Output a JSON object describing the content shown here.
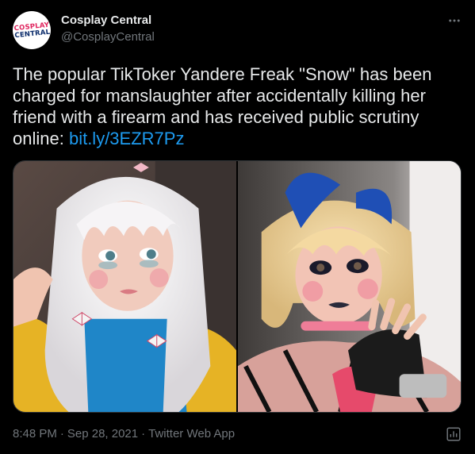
{
  "account": {
    "display_name": "Cosplay Central",
    "handle": "@CosplayCentral",
    "avatar_text_line1": "COSPLAY",
    "avatar_text_line2": "CENTRAL"
  },
  "tweet": {
    "text": "The popular TikToker Yandere Freak \"Snow\" has been charged for manslaughter after accidentally killing her friend with a firearm and has received public scrutiny online: ",
    "link_text": "bit.ly/3EZR7Pz"
  },
  "media": {
    "photo_count": 2,
    "left_photo": "photo of a person in a long white wig and a blue top with a yellow cardigan",
    "right_photo": "photo of a person in a blonde bob wig with blue cat ears and a pink choker"
  },
  "footer": {
    "time": "8:48 PM",
    "separator": "·",
    "date": "Sep 28, 2021",
    "source": "Twitter Web App"
  },
  "icons": {
    "more": "more-horizontal-icon",
    "analytics": "analytics-icon"
  },
  "colors": {
    "background": "#000000",
    "text": "#e7e9ea",
    "secondary": "#71767b",
    "link": "#1d9bf0"
  }
}
